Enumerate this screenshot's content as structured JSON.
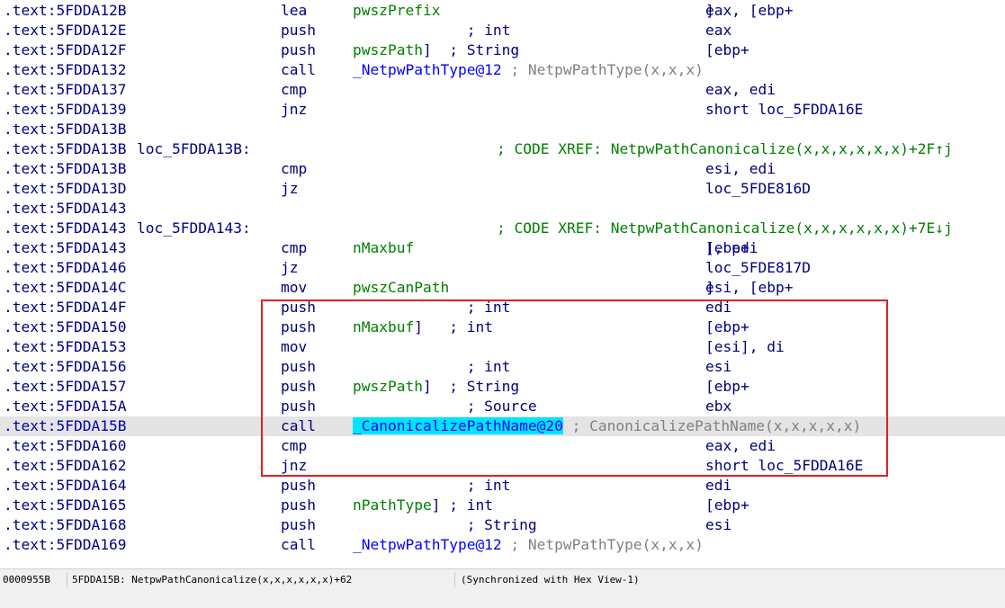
{
  "listing": {
    "rows": [
      {
        "addr": ".text:5FDDA12B",
        "label": "",
        "mnem": "lea",
        "ops": [
          {
            "t": "eax, [ebp+",
            "c": "op"
          },
          {
            "t": "pwszPrefix",
            "c": "var"
          },
          {
            "t": "]",
            "c": "op"
          }
        ],
        "xref": ""
      },
      {
        "addr": ".text:5FDDA12E",
        "label": "",
        "mnem": "push",
        "ops": [
          {
            "t": "eax",
            "c": "op"
          },
          {
            "t": "             ; int",
            "c": "cm"
          }
        ],
        "xref": ""
      },
      {
        "addr": ".text:5FDDA12F",
        "label": "",
        "mnem": "push",
        "ops": [
          {
            "t": "[ebp+",
            "c": "op"
          },
          {
            "t": "pwszPath",
            "c": "var"
          },
          {
            "t": "]  ; String",
            "c": "cm"
          }
        ],
        "xref": ""
      },
      {
        "addr": ".text:5FDDA132",
        "label": "",
        "mnem": "call",
        "ops": [
          {
            "t": "_NetpwPathType@12",
            "c": "fnc"
          },
          {
            "t": " ; NetpwPathType(x,x,x)",
            "c": "gray"
          }
        ],
        "xref": ""
      },
      {
        "addr": ".text:5FDDA137",
        "label": "",
        "mnem": "cmp",
        "ops": [
          {
            "t": "eax, edi",
            "c": "op"
          }
        ],
        "xref": ""
      },
      {
        "addr": ".text:5FDDA139",
        "label": "",
        "mnem": "jnz",
        "ops": [
          {
            "t": "short loc_5FDDA16E",
            "c": "op"
          }
        ],
        "xref": ""
      },
      {
        "addr": ".text:5FDDA13B",
        "label": "",
        "mnem": "",
        "ops": [],
        "xref": ""
      },
      {
        "addr": ".text:5FDDA13B",
        "label": "loc_5FDDA13B:",
        "mnem": "",
        "ops": [],
        "xref": "; CODE XREF: NetpwPathCanonicalize(x,x,x,x,x,x)+2F↑j"
      },
      {
        "addr": ".text:5FDDA13B",
        "label": "",
        "mnem": "cmp",
        "ops": [
          {
            "t": "esi, edi",
            "c": "op"
          }
        ],
        "xref": ""
      },
      {
        "addr": ".text:5FDDA13D",
        "label": "",
        "mnem": "jz",
        "ops": [
          {
            "t": "loc_5FDE816D",
            "c": "op"
          }
        ],
        "xref": ""
      },
      {
        "addr": ".text:5FDDA143",
        "label": "",
        "mnem": "",
        "ops": [],
        "xref": ""
      },
      {
        "addr": ".text:5FDDA143",
        "label": "loc_5FDDA143:",
        "mnem": "",
        "ops": [],
        "xref": "; CODE XREF: NetpwPathCanonicalize(x,x,x,x,x,x)+7E↓j"
      },
      {
        "addr": ".text:5FDDA143",
        "label": "",
        "mnem": "cmp",
        "ops": [
          {
            "t": "[ebp+",
            "c": "op"
          },
          {
            "t": "nMaxbuf",
            "c": "var"
          },
          {
            "t": "], edi",
            "c": "op"
          }
        ],
        "xref": ""
      },
      {
        "addr": ".text:5FDDA146",
        "label": "",
        "mnem": "jz",
        "ops": [
          {
            "t": "loc_5FDE817D",
            "c": "op"
          }
        ],
        "xref": ""
      },
      {
        "addr": ".text:5FDDA14C",
        "label": "",
        "mnem": "mov",
        "ops": [
          {
            "t": "esi, [ebp+",
            "c": "op"
          },
          {
            "t": "pwszCanPath",
            "c": "var"
          },
          {
            "t": "]",
            "c": "op"
          }
        ],
        "xref": ""
      },
      {
        "addr": ".text:5FDDA14F",
        "label": "",
        "mnem": "push",
        "ops": [
          {
            "t": "edi",
            "c": "op"
          },
          {
            "t": "             ; int",
            "c": "cm"
          }
        ],
        "xref": ""
      },
      {
        "addr": ".text:5FDDA150",
        "label": "",
        "mnem": "push",
        "ops": [
          {
            "t": "[ebp+",
            "c": "op"
          },
          {
            "t": "nMaxbuf",
            "c": "var"
          },
          {
            "t": "]   ; int",
            "c": "cm"
          }
        ],
        "xref": ""
      },
      {
        "addr": ".text:5FDDA153",
        "label": "",
        "mnem": "mov",
        "ops": [
          {
            "t": "[esi], di",
            "c": "op"
          }
        ],
        "xref": ""
      },
      {
        "addr": ".text:5FDDA156",
        "label": "",
        "mnem": "push",
        "ops": [
          {
            "t": "esi",
            "c": "op"
          },
          {
            "t": "             ; int",
            "c": "cm"
          }
        ],
        "xref": ""
      },
      {
        "addr": ".text:5FDDA157",
        "label": "",
        "mnem": "push",
        "ops": [
          {
            "t": "[ebp+",
            "c": "op"
          },
          {
            "t": "pwszPath",
            "c": "var"
          },
          {
            "t": "]  ; String",
            "c": "cm"
          }
        ],
        "xref": ""
      },
      {
        "addr": ".text:5FDDA15A",
        "label": "",
        "mnem": "push",
        "ops": [
          {
            "t": "ebx",
            "c": "op"
          },
          {
            "t": "             ; Source",
            "c": "cm"
          }
        ],
        "xref": ""
      },
      {
        "addr": ".text:5FDDA15B",
        "label": "",
        "mnem": "call",
        "current": true,
        "ops": [
          {
            "t": "_CanonicalizePathName@20",
            "c": "sel"
          },
          {
            "t": " ; CanonicalizePathName(x,x,x,x,x)",
            "c": "gray"
          }
        ],
        "xref": ""
      },
      {
        "addr": ".text:5FDDA160",
        "label": "",
        "mnem": "cmp",
        "ops": [
          {
            "t": "eax, edi",
            "c": "op"
          }
        ],
        "xref": ""
      },
      {
        "addr": ".text:5FDDA162",
        "label": "",
        "mnem": "jnz",
        "ops": [
          {
            "t": "short loc_5FDDA16E",
            "c": "op"
          }
        ],
        "xref": ""
      },
      {
        "addr": ".text:5FDDA164",
        "label": "",
        "mnem": "push",
        "ops": [
          {
            "t": "edi",
            "c": "op"
          },
          {
            "t": "             ; int",
            "c": "cm"
          }
        ],
        "xref": ""
      },
      {
        "addr": ".text:5FDDA165",
        "label": "",
        "mnem": "push",
        "ops": [
          {
            "t": "[ebp+",
            "c": "op"
          },
          {
            "t": "nPathType",
            "c": "var"
          },
          {
            "t": "] ; int",
            "c": "cm"
          }
        ],
        "xref": ""
      },
      {
        "addr": ".text:5FDDA168",
        "label": "",
        "mnem": "push",
        "ops": [
          {
            "t": "esi",
            "c": "op"
          },
          {
            "t": "             ; String",
            "c": "cm"
          }
        ],
        "xref": ""
      },
      {
        "addr": ".text:5FDDA169",
        "label": "",
        "mnem": "call",
        "ops": [
          {
            "t": "_NetpwPathType@12",
            "c": "fnc"
          },
          {
            "t": " ; NetpwPathType(x,x,x)",
            "c": "gray"
          }
        ],
        "xref": ""
      }
    ]
  },
  "statusbar": {
    "offset": "0000955B",
    "location": "5FDDA15B: NetpwPathCanonicalize(x,x,x,x,x,x)+62",
    "sync": "(Synchronized with Hex View-1)"
  },
  "colors": {
    "highlight_box": "#e02020",
    "selection": "#00e5ff",
    "current_line": "#e4e4e4"
  }
}
